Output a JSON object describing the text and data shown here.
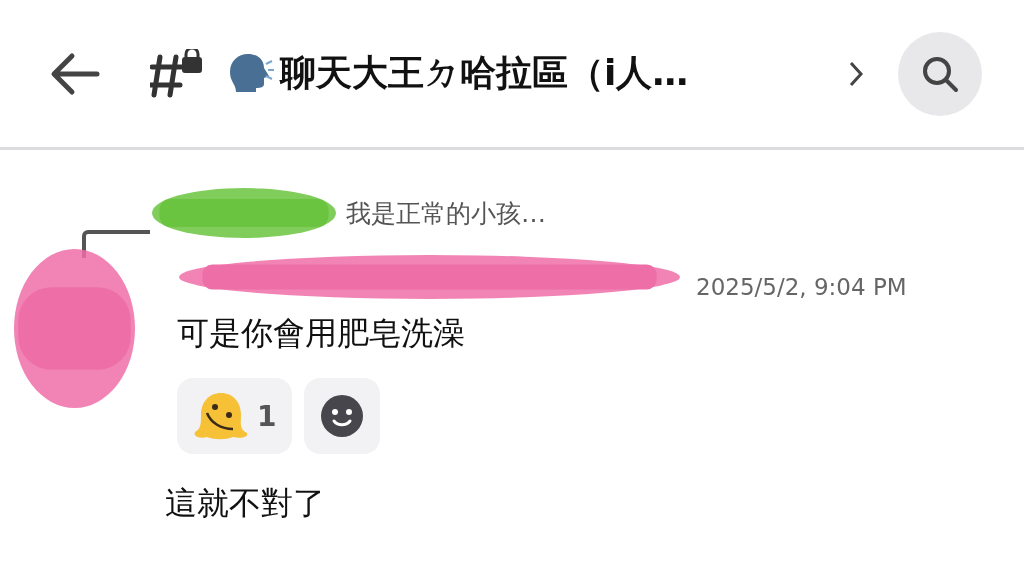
{
  "header": {
    "title": "聊天大王ㄉ哈拉區（i人…"
  },
  "reply": {
    "preview": "我是正常的小孩…"
  },
  "message": {
    "timestamp": "2025/5/2, 9:04 PM",
    "text": "可是你會用肥皂洗澡",
    "reactions": [
      {
        "count": "1"
      }
    ]
  },
  "followups": [
    {
      "text": "這就不對了"
    }
  ]
}
